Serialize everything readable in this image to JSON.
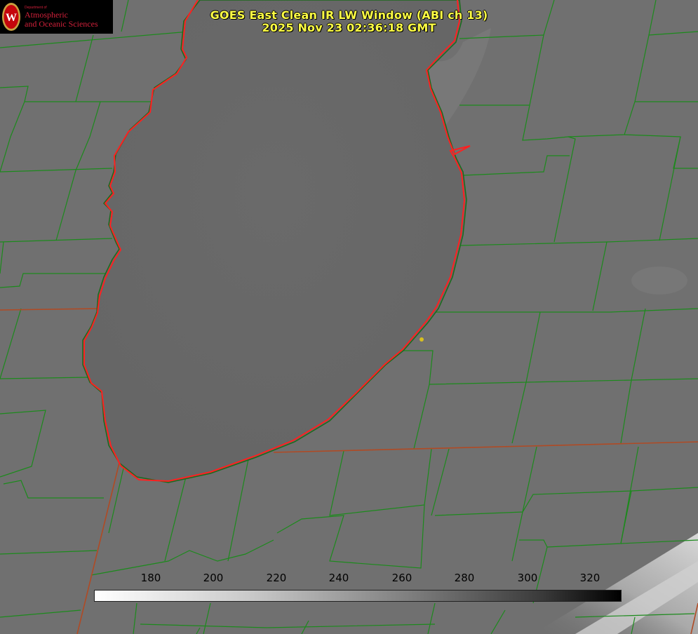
{
  "title": {
    "line1": "GOES East Clean IR LW Window (ABI ch 13)",
    "line2": "2025 Nov 23 02:36:18 GMT"
  },
  "logo": {
    "dept": "Department of",
    "line1": "Atmospheric",
    "line2": "and Oceanic Sciences",
    "seal_letter": "W"
  },
  "colorbar": {
    "ticks": [
      "180",
      "200",
      "220",
      "240",
      "260",
      "280",
      "300",
      "320"
    ]
  },
  "colors": {
    "title": "#ffff44",
    "county_lines": "#1c8a1c",
    "state_lines": "#c04020",
    "coastline": "#ff2020",
    "station_dot": "#d8c020",
    "logo_red": "#d0203a"
  }
}
